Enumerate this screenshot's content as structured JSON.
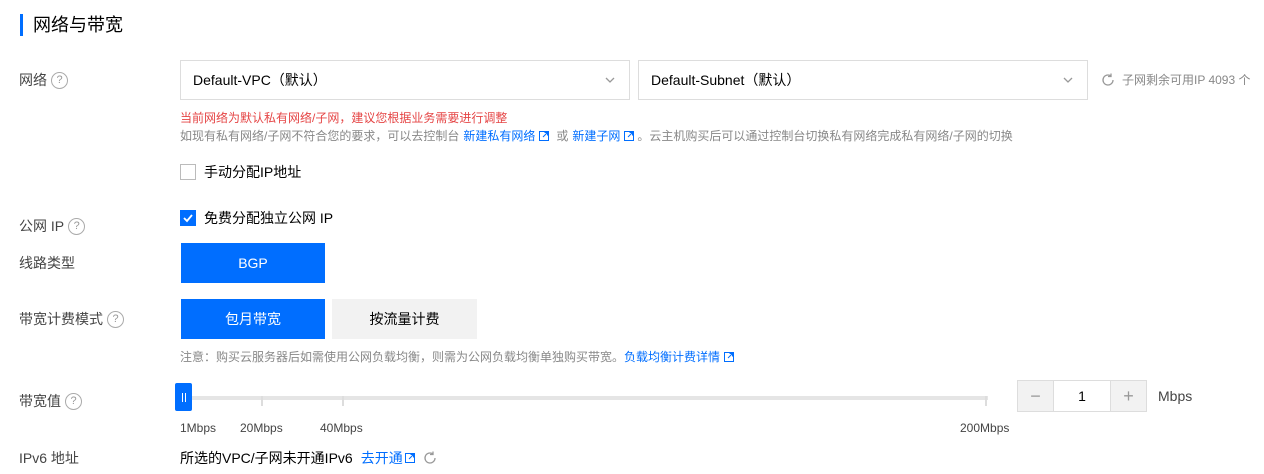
{
  "section": {
    "title": "网络与带宽"
  },
  "network": {
    "label": "网络",
    "vpc_value": "Default-VPC（默认）",
    "subnet_value": "Default-Subnet（默认）",
    "subnet_ip_info": "子网剩余可用IP 4093 个",
    "warning": "当前网络为默认私有网络/子网，建议您根据业务需要进行调整",
    "tip_prefix": "如现有私有网络/子网不符合您的要求，可以去控制台",
    "tip_link_vpc": "新建私有网络",
    "tip_or": "或",
    "tip_link_subnet": "新建子网",
    "tip_suffix": "。云主机购买后可以通过控制台切换私有网络完成私有网络/子网的切换",
    "manual_ip_label": "手动分配IP地址"
  },
  "public_ip": {
    "label": "公网 IP",
    "checkbox_label": "免费分配独立公网 IP"
  },
  "line_type": {
    "label": "线路类型",
    "option": "BGP"
  },
  "billing": {
    "label": "带宽计费模式",
    "option_monthly": "包月带宽",
    "option_traffic": "按流量计费",
    "note_prefix": "注意：购买云服务器后如需使用公网负载均衡，则需为公网负载均衡单独购买带宽。",
    "note_link": "负载均衡计费详情"
  },
  "bandwidth": {
    "label": "带宽值",
    "ticks": [
      "1Mbps",
      "20Mbps",
      "40Mbps",
      "200Mbps"
    ],
    "value": "1",
    "minus": "−",
    "plus": "+",
    "unit": "Mbps"
  },
  "ipv6": {
    "label": "IPv6 地址",
    "text": "所选的VPC/子网未开通IPv6",
    "link": "去开通"
  },
  "colors": {
    "accent": "#006eff",
    "warning": "#e54545"
  }
}
